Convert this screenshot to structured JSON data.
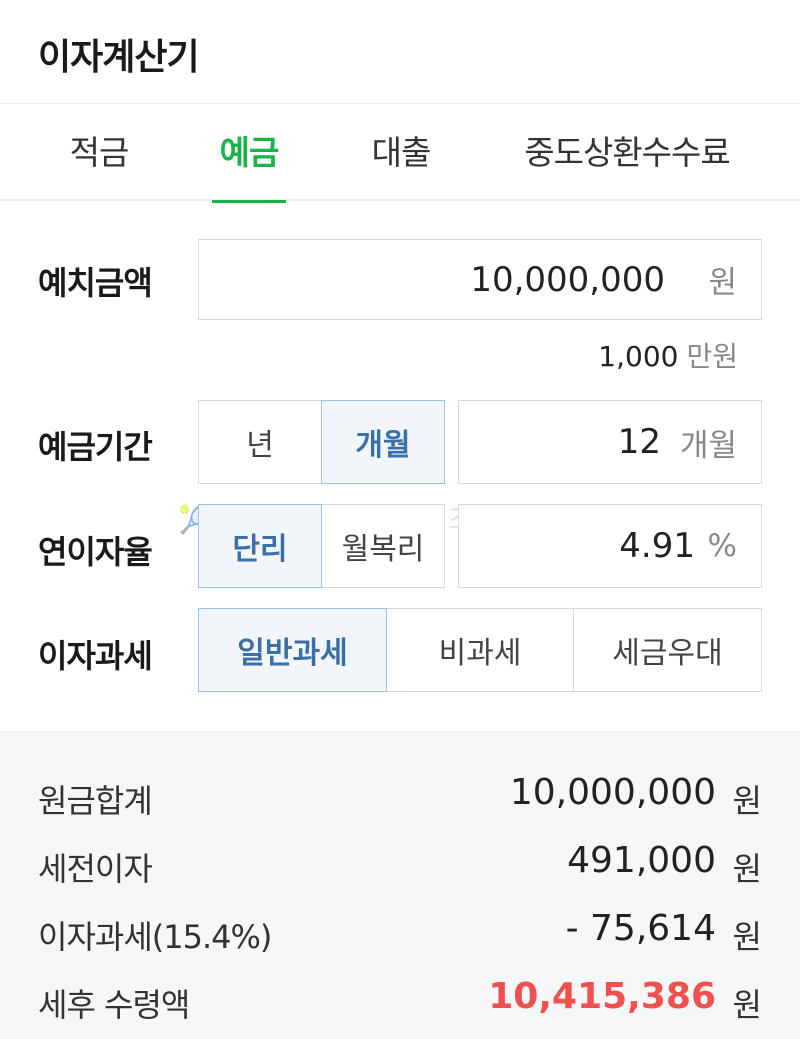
{
  "header": {
    "title": "이자계산기"
  },
  "tabs": [
    {
      "label": "적금",
      "active": false
    },
    {
      "label": "예금",
      "active": true
    },
    {
      "label": "대출",
      "active": false
    },
    {
      "label": "중도상환수수료",
      "active": false
    }
  ],
  "deposit_amount": {
    "label": "예치금액",
    "value": "10,000,000",
    "unit": "원",
    "helper_value": "1,000",
    "helper_unit": "만원"
  },
  "period": {
    "label": "예금기간",
    "options": [
      {
        "label": "년",
        "selected": false
      },
      {
        "label": "개월",
        "selected": true
      }
    ],
    "value": "12",
    "unit": "개월"
  },
  "rate": {
    "label": "연이자율",
    "options": [
      {
        "label": "단리",
        "selected": true
      },
      {
        "label": "월복리",
        "selected": false
      }
    ],
    "value": "4.91",
    "unit": "%"
  },
  "tax": {
    "label": "이자과세",
    "options": [
      {
        "label": "일반과세",
        "selected": true
      },
      {
        "label": "비과세",
        "selected": false
      },
      {
        "label": "세금우대",
        "selected": false
      }
    ]
  },
  "watermark": "🎾테리이 재테크 일상 조수코비🎾",
  "results": {
    "principal": {
      "label": "원금합계",
      "value": "10,000,000",
      "unit": "원"
    },
    "pre_tax_interest": {
      "label": "세전이자",
      "value": "491,000",
      "unit": "원"
    },
    "interest_tax": {
      "label": "이자과세(15.4%)",
      "value": "- 75,614",
      "unit": "원"
    },
    "net_amount": {
      "label": "세후 수령액",
      "value": "10,415,386",
      "unit": "원"
    }
  },
  "colors": {
    "accent_green": "#19b346",
    "selected_blue": "#3a6fa8",
    "highlight_red": "#f0504f"
  }
}
